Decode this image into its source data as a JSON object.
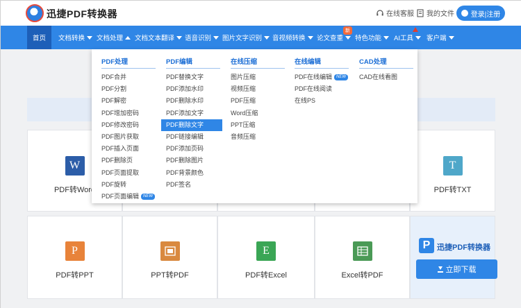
{
  "header": {
    "brand": "迅捷PDF转换器",
    "service_label": "在线客服",
    "files_label": "我的文件",
    "login_label": "登录|注册"
  },
  "nav": {
    "items": [
      {
        "label": "首页"
      },
      {
        "label": "文档转换"
      },
      {
        "label": "文档处理"
      },
      {
        "label": "文档文本翻译"
      },
      {
        "label": "语音识别"
      },
      {
        "label": "图片文字识别"
      },
      {
        "label": "音视频转换"
      },
      {
        "label": "论文查重"
      },
      {
        "label": "特色功能"
      },
      {
        "label": "AI工具"
      },
      {
        "label": "客户端"
      }
    ],
    "new_badge": "新",
    "accent": "#2f86e6"
  },
  "dropdown": {
    "columns": [
      {
        "title": "PDF处理",
        "items": [
          "PDF合并",
          "PDF分割",
          "PDF解密",
          "PDF增加密码",
          "PDF修改密码",
          "PDF图片获取",
          "PDF插入页面",
          "PDF删除页",
          "PDF页面提取",
          "PDF旋转",
          "PDF页面编辑"
        ]
      },
      {
        "title": "PDF编辑",
        "items": [
          "PDF替换文字",
          "PDF添加水印",
          "PDF删除水印",
          "PDF添加文字",
          "PDF删除文字",
          "PDF链接编辑",
          "PDF添加页码",
          "PDF删除图片",
          "PDF背景颜色",
          "PDF签名"
        ]
      },
      {
        "title": "在线压缩",
        "items": [
          "图片压缩",
          "视频压缩",
          "PDF压缩",
          "Word压缩",
          "PPT压缩",
          "音频压缩"
        ]
      },
      {
        "title": "在线编辑",
        "items": [
          "PDF在线编辑",
          "PDF在线阅读",
          "在线PS"
        ]
      },
      {
        "title": "CAD处理",
        "items": [
          "CAD在线看图"
        ]
      }
    ],
    "new_tag": "NEW",
    "highlighted": "PDF删除文字"
  },
  "tools": {
    "row1": [
      "PDF转Word",
      "PDF转TXT"
    ],
    "row2": [
      "PDF转PPT",
      "PPT转PDF",
      "PDF转Excel",
      "Excel转PDF"
    ],
    "icon_letters": {
      "word": "W",
      "txt": "T",
      "ppt": "P",
      "excel": "E"
    }
  },
  "promo": {
    "logo_letter": "P",
    "title": "迅捷PDF转换器",
    "button": "立即下载"
  }
}
